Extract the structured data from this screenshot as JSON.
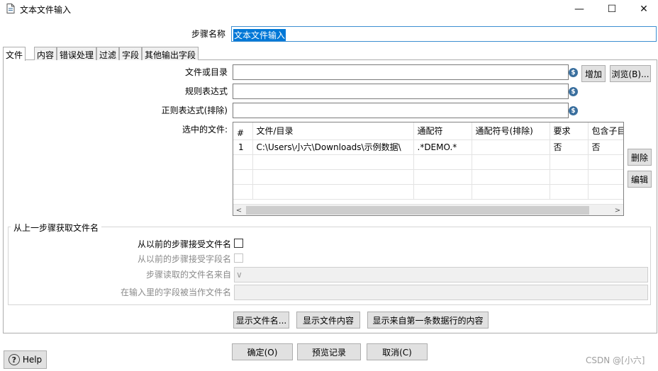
{
  "window": {
    "title": "文本文件输入",
    "minimize": "—",
    "maximize": "☐",
    "close": "✕"
  },
  "step_name": {
    "label": "步骤名称",
    "value": "文本文件输入"
  },
  "tabs": [
    {
      "label": "文件",
      "active": true
    },
    {
      "label": "内容"
    },
    {
      "label": "错误处理"
    },
    {
      "label": "过滤"
    },
    {
      "label": "字段"
    },
    {
      "label": "其他输出字段"
    }
  ],
  "file_tab": {
    "file_or_dir_label": "文件或目录",
    "file_or_dir_value": "",
    "regex_label": "规则表达式",
    "regex_value": "",
    "regex_exclude_label": "正则表达式(排除)",
    "regex_exclude_value": "",
    "add_button": "增加",
    "browse_button": "浏览(B)...",
    "selected_files_label": "选中的文件:",
    "delete_button": "删除",
    "edit_button": "编辑",
    "var_icon": "$"
  },
  "files_table": {
    "sort_indicator": "^",
    "headers": [
      "#",
      "文件/目录",
      "通配符",
      "通配符号(排除)",
      "要求",
      "包含子目"
    ],
    "rows": [
      [
        "1",
        "C:\\Users\\小六\\Downloads\\示例数据\\",
        ".*DEMO.*",
        "",
        "否",
        "否"
      ]
    ],
    "scroll_left": "<",
    "scroll_right": ">"
  },
  "prev_step_group": {
    "title": "从上一步骤获取文件名",
    "accept_filenames_label": "从以前的步骤接受文件名",
    "accept_filenames_checked": false,
    "accept_fieldname_label": "从以前的步骤接受字段名",
    "step_read_from_label": "步骤读取的文件名来自",
    "step_read_from_value": "",
    "field_as_filename_label": "在输入里的字段被当作文件名",
    "field_as_filename_value": "",
    "dropdown_arrow": "∨"
  },
  "show_buttons": {
    "show_filenames": "显示文件名...",
    "show_file_content": "显示文件内容",
    "show_first_row_content": "显示来自第一条数据行的内容"
  },
  "footer": {
    "ok": "确定(O)",
    "preview": "预览记录",
    "cancel": "取消(C)",
    "help": "Help",
    "help_icon": "?",
    "watermark": "CSDN @[小六]"
  }
}
